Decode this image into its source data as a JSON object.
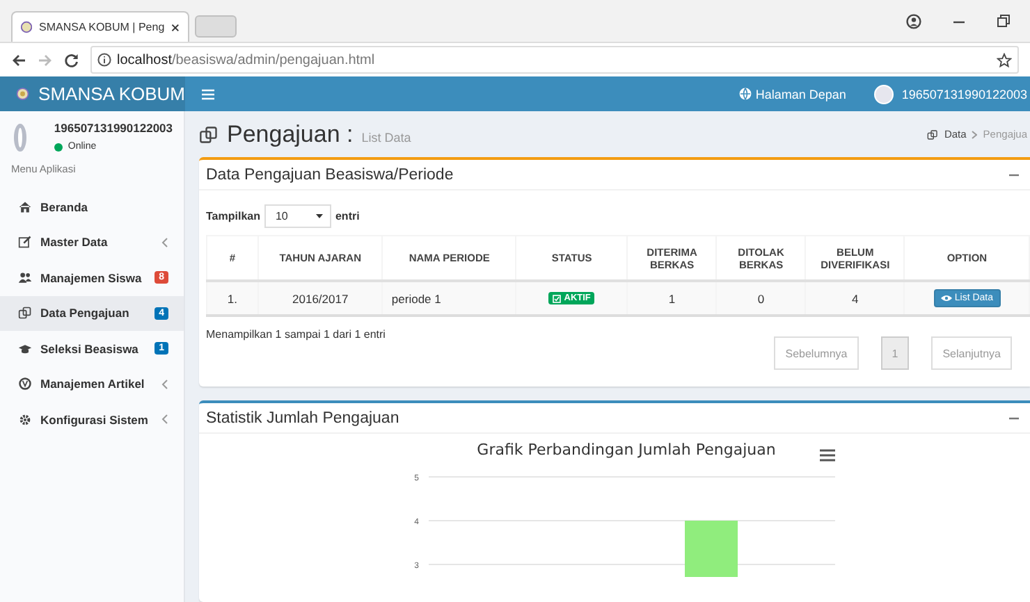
{
  "browser": {
    "tab_title": "SMANSA KOBUM | Peng",
    "address": {
      "host": "localhost",
      "path": "/beasiswa/admin/pengajuan.html"
    }
  },
  "header": {
    "brand": "SMANSA KOBUM",
    "home_link": "Halaman Depan",
    "user": "196507131990122003"
  },
  "sidebar": {
    "user": "196507131990122003",
    "status": "Online",
    "menu_heading": "Menu Aplikasi",
    "items": [
      {
        "label": "Beranda",
        "selected": false,
        "has_submenu": false
      },
      {
        "label": "Master Data",
        "selected": false,
        "has_submenu": true
      },
      {
        "label": "Manajemen Siswa",
        "selected": false,
        "has_submenu": false,
        "badge": {
          "text": "8",
          "color": "#dd4b39"
        }
      },
      {
        "label": "Data Pengajuan",
        "selected": true,
        "has_submenu": false,
        "badge": {
          "text": "4",
          "color": "#0073b7"
        }
      },
      {
        "label": "Seleksi Beasiswa",
        "selected": false,
        "has_submenu": false,
        "badge": {
          "text": "1",
          "color": "#0073b7"
        }
      },
      {
        "label": "Manajemen Artikel",
        "selected": false,
        "has_submenu": true
      },
      {
        "label": "Konfigurasi Sistem",
        "selected": false,
        "has_submenu": true
      }
    ]
  },
  "page": {
    "title": "Pengajuan :",
    "subtitle": "List Data",
    "breadcrumb": [
      "Data",
      "Pengajua"
    ]
  },
  "data_box": {
    "title": "Data Pengajuan Beasiswa/Periode",
    "length_label": "Tampilkan",
    "length_value": "10",
    "length_suffix": "entri",
    "table": {
      "columns": [
        "#",
        "TAHUN AJARAN",
        "NAMA PERIODE",
        "STATUS",
        "DITERIMA BERKAS",
        "DITOLAK BERKAS",
        "BELUM DIVERIFIKASI",
        "OPTION"
      ],
      "rows": [
        {
          "number": "1.",
          "year": "2016/2017",
          "period": "periode 1",
          "status": "AKTIF",
          "accepted": "1",
          "rejected": "0",
          "unverified": "4",
          "action": "List Data"
        }
      ]
    },
    "info": "Menampilkan 1 sampai 1 dari 1 entri",
    "pagination": {
      "previous": "Sebelumnya",
      "pages": [
        {
          "label": "1",
          "selected": true
        }
      ],
      "next": "Selanjutnya"
    }
  },
  "stats_box": {
    "title": "Statistik Jumlah Pengajuan",
    "chart_data": {
      "type": "bar",
      "title": "Grafik Perbandingan Jumlah Pengajuan",
      "ylim": [
        0,
        5
      ],
      "yticks": [
        3,
        4,
        5
      ],
      "series": [
        {
          "color": "#90ed7d",
          "values": [
            4
          ]
        }
      ]
    }
  }
}
